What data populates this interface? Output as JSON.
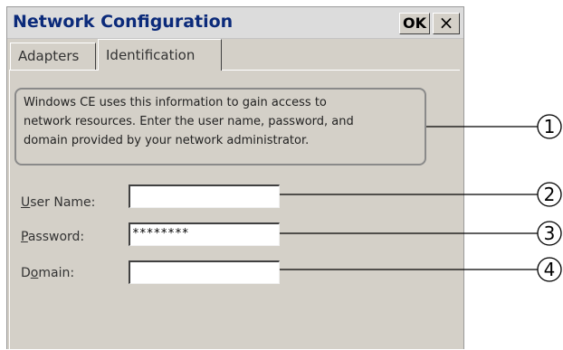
{
  "window": {
    "title": "Network Configuration",
    "ok_label": "OK",
    "close_label": "×"
  },
  "tabs": [
    {
      "label": "Adapters"
    },
    {
      "label": "Identification"
    }
  ],
  "info": {
    "lines": [
      "Windows CE uses this information to gain access to",
      "network resources. Enter the user name, password, and",
      "domain provided by your network administrator."
    ]
  },
  "form": {
    "user_name": {
      "label_pre": "",
      "label_key": "U",
      "label_post": "ser Name:",
      "value": ""
    },
    "password": {
      "label_pre": "",
      "label_key": "P",
      "label_post": "assword:",
      "value": "********"
    },
    "domain": {
      "label_pre": "D",
      "label_key": "o",
      "label_post": "main:",
      "value": ""
    }
  },
  "callouts": [
    "1",
    "2",
    "3",
    "4"
  ]
}
